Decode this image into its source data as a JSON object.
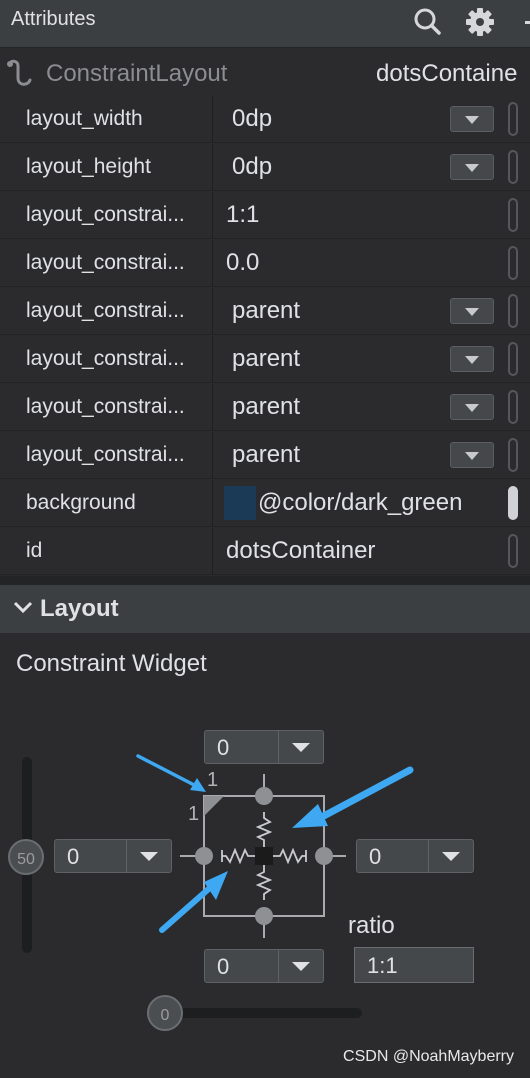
{
  "header": {
    "title": "Attributes",
    "icons": [
      "search-icon",
      "gear-icon",
      "minimize-icon"
    ]
  },
  "component": {
    "type": "ConstraintLayout",
    "id": "dotsContaine"
  },
  "attributes": [
    {
      "name": "layout_width",
      "value": "0dp",
      "dropdown": true
    },
    {
      "name": "layout_height",
      "value": "0dp",
      "dropdown": true
    },
    {
      "name": "layout_constrai...",
      "value": "1:1",
      "dropdown": false
    },
    {
      "name": "layout_constrai...",
      "value": "0.0",
      "dropdown": false
    },
    {
      "name": "layout_constrai...",
      "value": "parent",
      "dropdown": true
    },
    {
      "name": "layout_constrai...",
      "value": "parent",
      "dropdown": true
    },
    {
      "name": "layout_constrai...",
      "value": "parent",
      "dropdown": true
    },
    {
      "name": "layout_constrai...",
      "value": "parent",
      "dropdown": true
    },
    {
      "name": "background",
      "value": "@color/dark_green",
      "dropdown": false,
      "color": "#1a3a55"
    },
    {
      "name": "id",
      "value": "dotsContainer",
      "dropdown": false
    }
  ],
  "layout_section": {
    "title": "Layout"
  },
  "constraint_widget": {
    "title": "Constraint Widget",
    "top_margin": "0",
    "bottom_margin": "0",
    "left_margin": "0",
    "right_margin": "0",
    "vertical_bias": "50",
    "horizontal_bias": "0",
    "ratio_label": "ratio",
    "ratio_value": "1:1",
    "ratio_top_marker": "1",
    "ratio_left_marker": "1"
  },
  "colors": {
    "accent_arrow": "#3ea8f2",
    "panel": "#2b2b2d",
    "header": "#3c3f41"
  },
  "watermark": "CSDN @NoahMayberry"
}
